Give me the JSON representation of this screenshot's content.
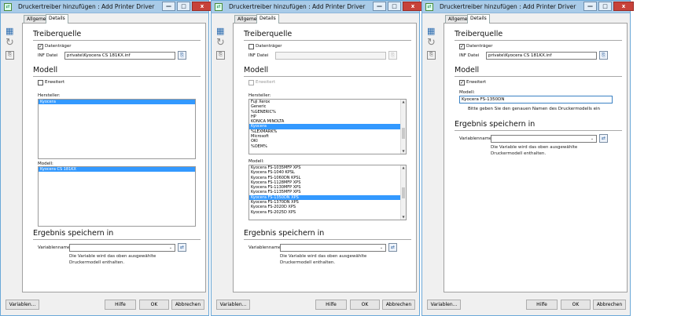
{
  "title": "Druckertreiber hinzufügen : Add Printer Driver",
  "tabs": {
    "general": "Allgemein",
    "details": "Details"
  },
  "sections": {
    "driver_source": "Treiberquelle",
    "model": "Modell",
    "save_result": "Ergebnis speichern in"
  },
  "labels": {
    "data_carrier": "Datenträger",
    "inf_file": "INF Datei",
    "extended": "Erweitert",
    "manufacturer": "Hersteller:",
    "model_list": "Modell:",
    "model_field": "Modell:",
    "variable_name": "Variablenname",
    "variable_note_1": "Die Variable wird das oben ausgewählte",
    "variable_note_2": "Druckermodell enthalten.",
    "model_hint": "Bitte geben Sie den genauen Namen des Druckermodells ein"
  },
  "buttons": {
    "variables": "Variablen...",
    "help": "Hilfe",
    "ok": "OK",
    "cancel": "Abbrechen"
  },
  "window_buttons": {
    "minimize": "—",
    "maximize": "□",
    "close": "x"
  },
  "icons": {
    "grid": "▦",
    "refresh": "↻",
    "browse": "⎘",
    "variable": "⇄",
    "dropdown": "⌄",
    "check": "✓"
  },
  "win1": {
    "inf_path": "private\\Kyocera CS 181KX.inf",
    "manufacturers": [
      "Kyocera"
    ],
    "models": [
      "Kyocera CS 181KX"
    ]
  },
  "win2": {
    "manufacturers": [
      "Fuji Xerox",
      "Generic",
      "%GENERIC%",
      "HP",
      "KONICA MINOLTA",
      "Kyocera",
      "%LEXMARK%",
      "Microsoft",
      "OKI",
      "%OEM%"
    ],
    "models": [
      "Kyocera FS-1035MFP XPS",
      "Kyocera FS-1040 KPSL",
      "Kyocera FS-1060DN KPSL",
      "Kyocera FS-1128MFP XPS",
      "Kyocera FS-1130MFP XPS",
      "Kyocera FS-1135MFP XPS",
      "Kyocera FS-1350DN XPS",
      "Kyocera FS-1370DN XPS",
      "Kyocera FS-2020D XPS",
      "Kyocera FS-2025D XPS"
    ]
  },
  "win3": {
    "inf_path": "private\\Kyocera CS 181KX.inf",
    "model_value": "Kyocera FS-1350DN"
  }
}
